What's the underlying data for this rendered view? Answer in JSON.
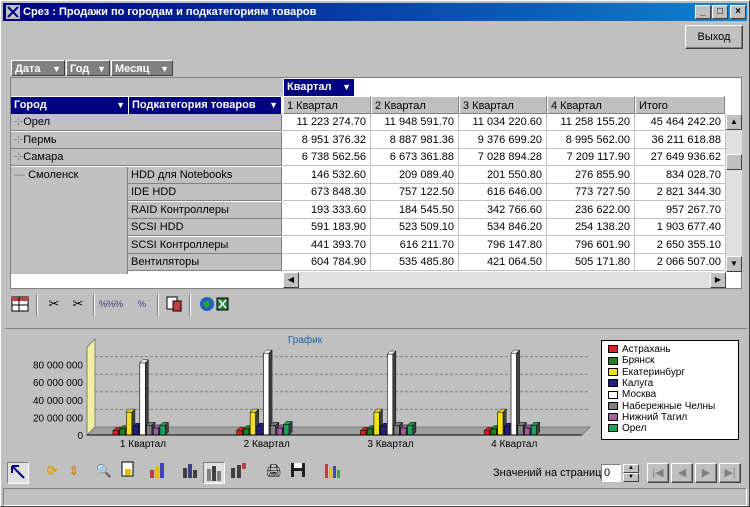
{
  "window": {
    "title": "Срез : Продажи по городам и подкатегориям товаров",
    "buttons": [
      "_",
      "□",
      "×"
    ]
  },
  "exit_button": "Выход",
  "filters": [
    {
      "label": "Дата"
    },
    {
      "label": "Год"
    },
    {
      "label": "Месяц"
    }
  ],
  "column_field": "Квартал",
  "row_fields": [
    "Город",
    "Подкатегория товаров"
  ],
  "columns": [
    "1 Квартал",
    "2 Квартал",
    "3 Квартал",
    "4 Квартал",
    "Итого"
  ],
  "rows": [
    {
      "city": "Орел",
      "sub": "",
      "values": [
        "11 223 274.70",
        "11 948 591.70",
        "11 034 220.60",
        "11 258 155.20",
        "45 464 242.20"
      ]
    },
    {
      "city": "Пермь",
      "sub": "",
      "values": [
        "8 951 376.32",
        "8 887 981.36",
        "9 376 699.20",
        "8 995 562.00",
        "36 211 618.88"
      ]
    },
    {
      "city": "Самара",
      "sub": "",
      "values": [
        "6 738 562.56",
        "6 673 361.88",
        "7 028 894.28",
        "7 209 117.90",
        "27 649 936.62"
      ]
    },
    {
      "city": "Смоленск",
      "sub": "HDD для Notebooks",
      "values": [
        "146 532.60",
        "209 089.40",
        "201 550.80",
        "276 855.90",
        "834 028.70"
      ]
    },
    {
      "city": "",
      "sub": "IDE HDD",
      "values": [
        "673 848.30",
        "757 122.50",
        "616 646.00",
        "773 727.50",
        "2 821 344.30"
      ]
    },
    {
      "city": "",
      "sub": "RAID Контроллеры",
      "values": [
        "193 333.60",
        "184 545.50",
        "342 766.60",
        "236 622.00",
        "957 267.70"
      ]
    },
    {
      "city": "",
      "sub": "SCSI HDD",
      "values": [
        "591 183.90",
        "523 509.10",
        "534 846.20",
        "254 138.20",
        "1 903 677.40"
      ]
    },
    {
      "city": "",
      "sub": "SCSI Контроллеры",
      "values": [
        "441 393.70",
        "616 211.70",
        "796 147.80",
        "796 601.90",
        "2 650 355.10"
      ]
    },
    {
      "city": "",
      "sub": "Вентиляторы",
      "values": [
        "604 784.90",
        "535 485.80",
        "421 064.50",
        "505 171.80",
        "2 066 507.00"
      ]
    }
  ],
  "chart_title": "График",
  "pager": {
    "label": "Значений на странице",
    "value": "0"
  },
  "colors": {
    "title_start": "#000080",
    "title_end": "#1084d0",
    "face": "#c0c0c0"
  },
  "chart_data": {
    "type": "bar",
    "title": "График",
    "categories": [
      "1 Квартал",
      "2 Квартал",
      "3 Квартал",
      "4 Квартал"
    ],
    "ylim": [
      0,
      100000000
    ],
    "yticks": [
      "0",
      "20 000 000",
      "40 000 000",
      "60 000 000",
      "80 000 000"
    ],
    "series": [
      {
        "name": "Астрахань",
        "color": "#e02020",
        "values": [
          5000000,
          5000000,
          5000000,
          5000000
        ]
      },
      {
        "name": "Брянск",
        "color": "#208020",
        "values": [
          7000000,
          7000000,
          7000000,
          7000000
        ]
      },
      {
        "name": "Екатеринбург",
        "color": "#f0e020",
        "values": [
          26000000,
          26000000,
          26000000,
          26000000
        ]
      },
      {
        "name": "Калуга",
        "color": "#202080",
        "values": [
          10000000,
          10000000,
          10000000,
          10000000
        ]
      },
      {
        "name": "Москва",
        "color": "#ffffff",
        "values": [
          82000000,
          93000000,
          92000000,
          93000000
        ]
      },
      {
        "name": "Набережные Челны",
        "color": "#808080",
        "values": [
          11000000,
          11000000,
          11000000,
          11000000
        ]
      },
      {
        "name": "Нижний Тагил",
        "color": "#a060a0",
        "values": [
          8000000,
          8000000,
          8000000,
          8000000
        ]
      },
      {
        "name": "Орел",
        "color": "#20a060",
        "values": [
          11000000,
          12000000,
          11000000,
          11000000
        ]
      }
    ],
    "grid": true,
    "legend": "right"
  }
}
